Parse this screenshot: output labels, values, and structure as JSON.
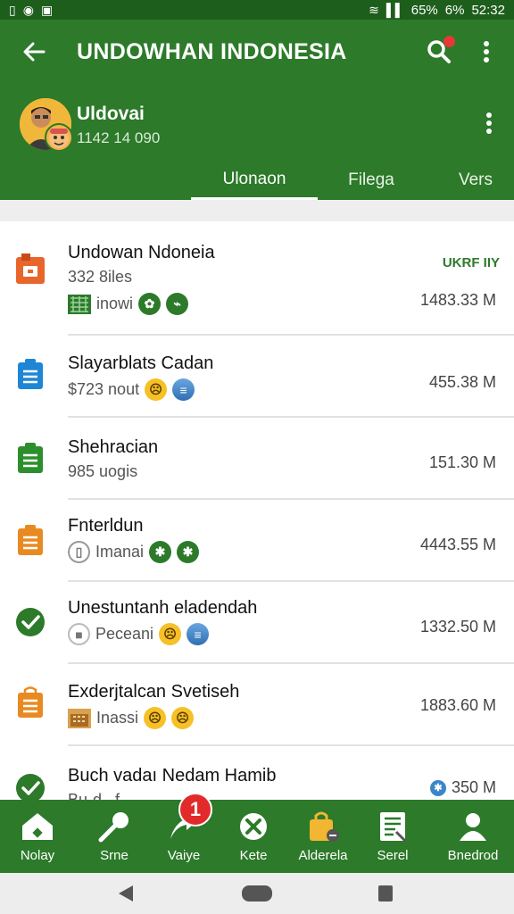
{
  "status_bar": {
    "left_icons": [
      "sim-icon",
      "record-icon",
      "photo-icon"
    ],
    "battery_a": "65%",
    "battery_b": "6%",
    "time": "52:32"
  },
  "header": {
    "title": "UNDOWHAN INDONESIA",
    "search_badge": "",
    "profile": {
      "name": "Uldovai",
      "subtitle": "1142 14 090"
    },
    "tabs": [
      {
        "label": "Ulonaon",
        "active": true
      },
      {
        "label": "Filega",
        "active": false
      },
      {
        "label": "Vers",
        "active": false
      }
    ]
  },
  "list": [
    {
      "icon": "orange-bag-icon",
      "icon_color": "#e8652c",
      "title": "Undowan Ndoneia",
      "subtitle": "332 8iles",
      "meta": "inowi",
      "meta_icons": [
        "grid-thumb-icon",
        "green-chip-icon",
        "green-chip-icon"
      ],
      "tag": "UKRF IIY",
      "size": "1483.33 M"
    },
    {
      "icon": "blue-bag-icon",
      "icon_color": "#1f86d6",
      "title": "Slayarblats  Cadan",
      "subtitle": "$723 nout",
      "meta_icons": [
        "emoji-face-icon",
        "globe-icon"
      ],
      "size": "455.38 M"
    },
    {
      "icon": "green-bag-icon",
      "icon_color": "#2c8f2c",
      "title": "Shehracian",
      "subtitle": "985 uogis",
      "meta_icons": [],
      "size": "151.30 M"
    },
    {
      "icon": "orange-bag-icon",
      "icon_color": "#e88a22",
      "title": "Fnterldun",
      "meta": "Imanai",
      "meta_icons": [
        "outline-chip-icon",
        "green-chip-icon",
        "green-chip-icon"
      ],
      "size": "4443.55 M"
    },
    {
      "icon": "check-circle-icon",
      "icon_color": "#2c7a2a",
      "title": "Unestuntanh eladendah",
      "meta": "Pecеani",
      "meta_icons": [
        "gray-box-icon",
        "emoji-face-icon",
        "globe-icon"
      ],
      "size": "1332.50 M"
    },
    {
      "icon": "orange-bag-icon",
      "icon_color": "#e88a22",
      "title": "Exderjtalcan Svetiseh",
      "meta": "Inassi",
      "meta_icons": [
        "building-thumb-icon",
        "emoji-face-icon",
        "emoji-face-icon"
      ],
      "size": "1883.60 M"
    },
    {
      "icon": "check-circle-icon",
      "icon_color": "#2c7a2a",
      "title": "Buch vadaı Nedam Hamib",
      "subtitle": "Bu-d...f",
      "meta_icons": [
        "blue-gear-icon"
      ],
      "size": "350 M"
    }
  ],
  "bottom_nav": [
    {
      "label": "Nolay",
      "icon": "home-icon"
    },
    {
      "label": "Srne",
      "icon": "pin-icon"
    },
    {
      "label": "Vaiye",
      "icon": "share-icon"
    },
    {
      "label": "Kete",
      "icon": "cancel-icon"
    },
    {
      "label": "Alderela",
      "icon": "bag-icon"
    },
    {
      "label": "Serel",
      "icon": "document-icon"
    },
    {
      "label": "Bnedrod",
      "icon": "person-icon"
    }
  ],
  "nav_badge": "1",
  "colors": {
    "primary": "#2c7a2a",
    "primary_dark": "#1e5e1c",
    "badge": "#e32a2a"
  }
}
